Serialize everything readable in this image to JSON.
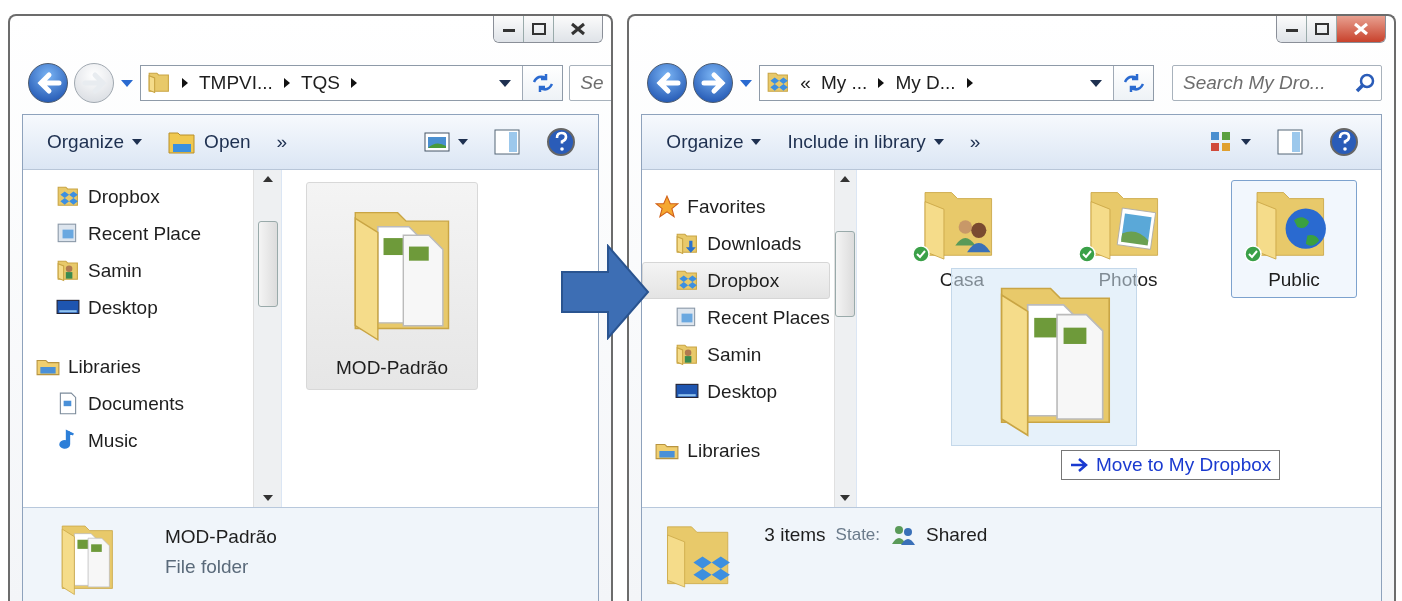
{
  "windows": [
    {
      "active": false,
      "forward_enabled": false,
      "address": {
        "crumbs": [
          "TMPVI...",
          "TQS"
        ]
      },
      "search": {
        "placeholder": "Se"
      },
      "toolbar": [
        {
          "kind": "menu",
          "label": "Organize"
        },
        {
          "kind": "open",
          "label": "Open"
        },
        {
          "kind": "more",
          "label": "»"
        },
        {
          "kind": "views"
        },
        {
          "kind": "pane"
        },
        {
          "kind": "help"
        }
      ],
      "nav": [
        {
          "children": [
            {
              "label": "Dropbox",
              "kind": "dropbox",
              "selected": false
            },
            {
              "label": "Recent Place",
              "kind": "recent",
              "selected": false
            },
            {
              "label": "Samin",
              "kind": "user",
              "selected": false
            },
            {
              "label": "Desktop",
              "kind": "desktop",
              "selected": false
            }
          ]
        },
        {
          "label": "Libraries",
          "kind": "libraries",
          "children": [
            {
              "label": "Documents",
              "kind": "documents",
              "selected": false
            },
            {
              "label": "Music",
              "kind": "music",
              "selected": false
            }
          ]
        }
      ],
      "items": [
        {
          "name": "MOD-Padrão",
          "kind": "docs",
          "synced": false,
          "selected": true
        }
      ],
      "details": {
        "title": "MOD-Padrão",
        "subtitle": "File folder"
      }
    },
    {
      "active": true,
      "forward_enabled": true,
      "address": {
        "overflow_marker": "«",
        "crumbs": [
          "My ...",
          "My D..."
        ]
      },
      "search": {
        "placeholder": "Search My Dro..."
      },
      "toolbar": [
        {
          "kind": "menu",
          "label": "Organize"
        },
        {
          "kind": "menu",
          "label": "Include in library"
        },
        {
          "kind": "more",
          "label": "»"
        },
        {
          "kind": "views-grid"
        },
        {
          "kind": "pane"
        },
        {
          "kind": "help"
        }
      ],
      "nav": [
        {
          "label": "Favorites",
          "kind": "star",
          "children": [
            {
              "label": "Downloads",
              "kind": "downloads",
              "selected": false
            },
            {
              "label": "Dropbox",
              "kind": "dropbox",
              "selected": true
            },
            {
              "label": "Recent Places",
              "kind": "recent",
              "selected": false
            },
            {
              "label": "Samin",
              "kind": "user",
              "selected": false
            },
            {
              "label": "Desktop",
              "kind": "desktop",
              "selected": false
            }
          ]
        },
        {
          "label": "Libraries",
          "kind": "libraries"
        }
      ],
      "items": [
        {
          "name": "Casa",
          "kind": "people",
          "synced": true,
          "selected": false
        },
        {
          "name": "Photos",
          "kind": "photo",
          "synced": true,
          "selected": false
        },
        {
          "name": "Public",
          "kind": "globe",
          "synced": true,
          "selected": true
        }
      ],
      "drag": {
        "tooltip": "Move to My Dropbox"
      },
      "details": {
        "count": "3 items",
        "state_label": "State:",
        "state_value": "Shared"
      }
    }
  ]
}
